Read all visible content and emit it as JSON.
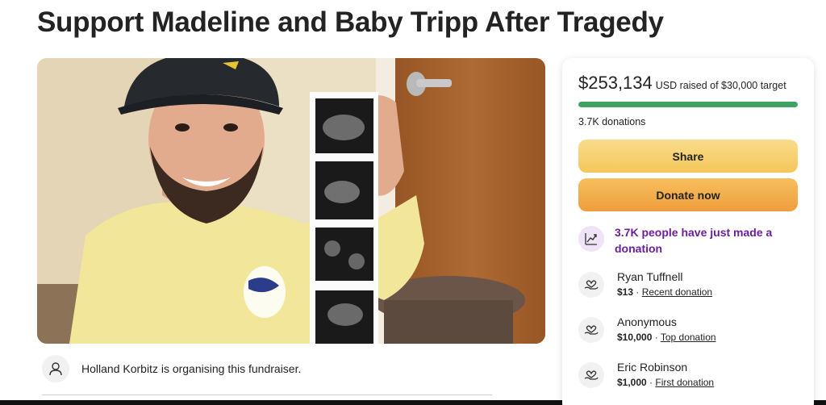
{
  "page": {
    "title": "Support Madeline and Baby Tripp After Tragedy"
  },
  "hero": {
    "image_alt": "Young man in a cap and yellow shirt smiling and holding up a strip of ultrasound images"
  },
  "organiser": {
    "text": "Holland Korbitz is organising this fundraiser.",
    "icon": "person-icon"
  },
  "donation_card": {
    "amount": "$253,134",
    "raised_text": "USD raised of $30,000 target",
    "progress_fraction": 1.0,
    "donations_count": "3.7K donations",
    "share_label": "Share",
    "donate_label": "Donate now",
    "promo_text": "3.7K people have just made a donation",
    "promo_icon": "trending-up-icon",
    "donors": [
      {
        "name": "Ryan Tuffnell",
        "amount": "$13",
        "separator": " · ",
        "tag": "Recent donation",
        "icon": "heart-hand-icon"
      },
      {
        "name": "Anonymous",
        "amount": "$10,000",
        "separator": " · ",
        "tag": "Top donation",
        "icon": "heart-hand-icon"
      },
      {
        "name": "Eric Robinson",
        "amount": "$1,000",
        "separator": " · ",
        "tag": "First donation",
        "icon": "heart-hand-icon"
      }
    ]
  },
  "colors": {
    "progress_green": "#3fa262",
    "share_yellow": "#f6d06f",
    "donate_orange": "#f2ac48",
    "promo_purple": "#6b1f9b"
  }
}
